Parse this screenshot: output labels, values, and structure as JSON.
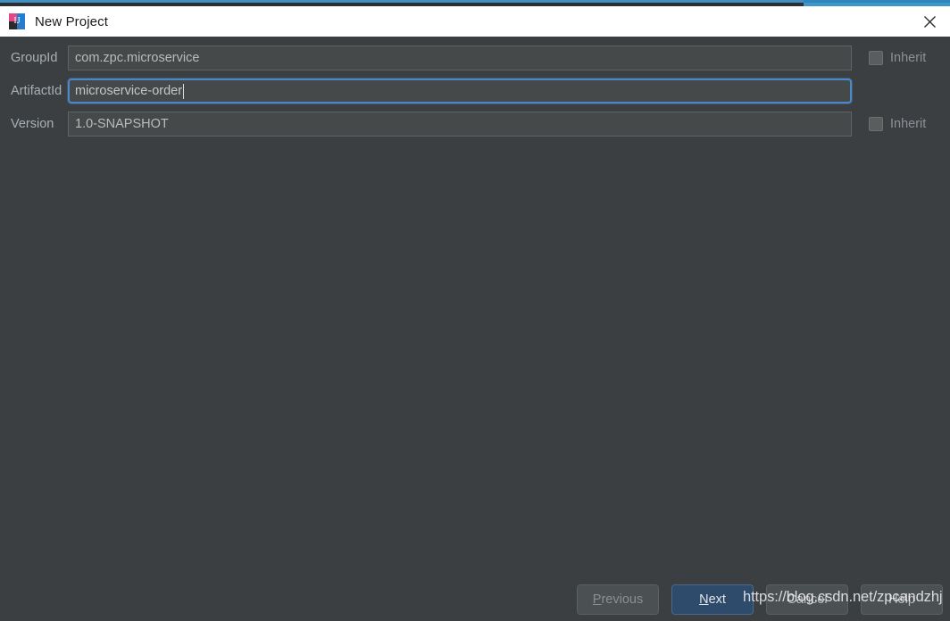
{
  "window": {
    "title": "New Project",
    "app_icon": "intellij-idea-icon",
    "close_label": "✕"
  },
  "theme": {
    "background": "#3c3f41",
    "titlebar_background": "#ffffff",
    "field_background": "#45494a",
    "focus_border": "#4a88c7",
    "default_button_background": "#2e4b6b",
    "accent_strip": "#3d8fc4"
  },
  "form": {
    "rows": [
      {
        "label": "GroupId",
        "value": "com.zpc.microservice",
        "placeholder": "com.example",
        "focused": false,
        "inherit": {
          "label": "Inherit",
          "checked": false
        }
      },
      {
        "label": "ArtifactId",
        "value": "microservice-order",
        "placeholder": "artifact-id",
        "focused": true,
        "inherit": null
      },
      {
        "label": "Version",
        "value": "1.0-SNAPSHOT",
        "placeholder": "1.0-SNAPSHOT",
        "focused": false,
        "inherit": {
          "label": "Inherit",
          "checked": false
        }
      }
    ]
  },
  "footer": {
    "previous": {
      "label": "Previous",
      "mnemonic": "P",
      "rest": "revious",
      "disabled": true
    },
    "next": {
      "label": "Next",
      "mnemonic": "N",
      "rest": "ext",
      "default": true
    },
    "cancel": {
      "label": "Cancel",
      "mnemonic": "",
      "rest": "Cancel"
    },
    "help": {
      "label": "Help",
      "mnemonic": "",
      "rest": "Help"
    }
  },
  "watermark": {
    "text": "https://blog.csdn.net/zpcandzhj"
  }
}
